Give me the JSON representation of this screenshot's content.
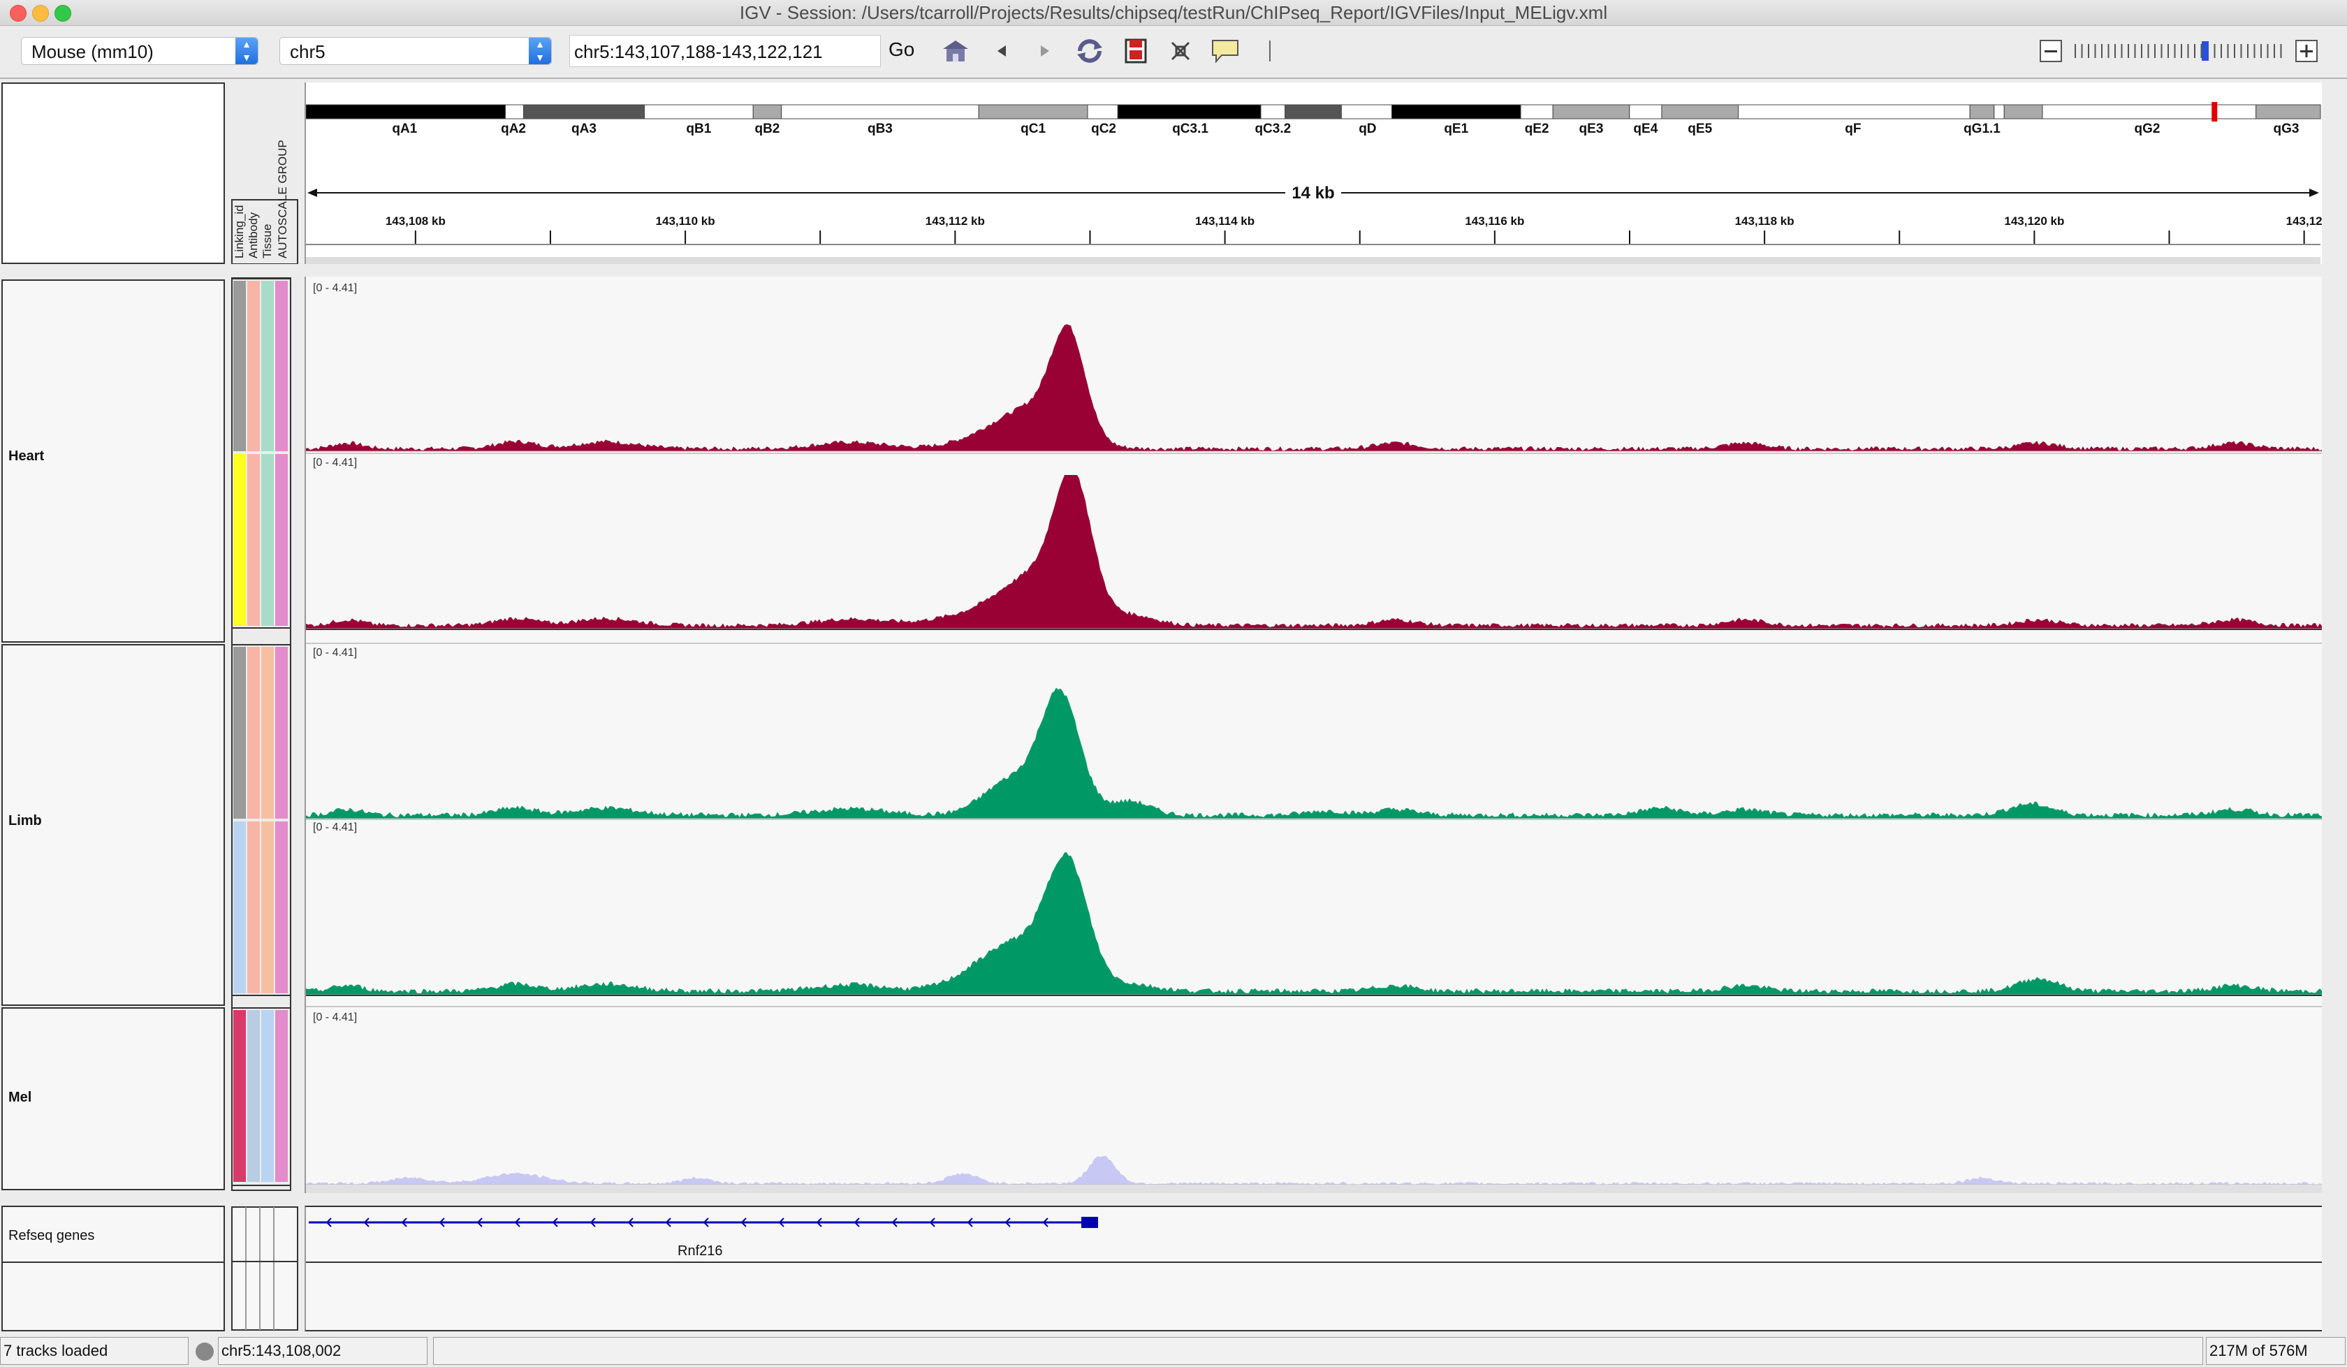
{
  "window": {
    "title": "IGV - Session: /Users/tcarroll/Projects/Results/chipseq/testRun/ChIPseq_Report/IGVFiles/Input_MELigv.xml"
  },
  "toolbar": {
    "genome": "Mouse (mm10)",
    "chromosome": "chr5",
    "locus": "chr5:143,107,188-143,122,121",
    "go_label": "Go",
    "icons": [
      "home-icon",
      "back-icon",
      "forward-icon",
      "refresh-icon",
      "region-icon",
      "resize-icon",
      "popup-text-icon",
      "ruler-divider-icon"
    ]
  },
  "ideogram": {
    "bands": [
      "qA1",
      "qA2",
      "qA3",
      "qB1",
      "qB2",
      "qB3",
      "qC1",
      "qC2",
      "qC3.1",
      "qC3.2",
      "qD",
      "qE1",
      "qE2",
      "qE3",
      "qE4",
      "qE5",
      "qF",
      "qG1.1",
      "qG2",
      "qG3"
    ]
  },
  "ruler": {
    "span_label": "14 kb",
    "ticks": [
      "143,108 kb",
      "143,110 kb",
      "143,112 kb",
      "143,114 kb",
      "143,116 kb",
      "143,118 kb",
      "143,120 kb",
      "143,12"
    ]
  },
  "attributes": {
    "headers": [
      "Linking_id",
      "Antibody",
      "Tissue",
      "AUTOSCALE GROUP"
    ]
  },
  "groups": [
    {
      "name": "Heart",
      "color": "#990033",
      "tracks": [
        {
          "range": "[0 - 4.41]"
        },
        {
          "range": "[0 - 4.41]"
        }
      ]
    },
    {
      "name": "Limb",
      "color": "#009966",
      "tracks": [
        {
          "range": "[0 - 4.41]"
        },
        {
          "range": "[0 - 4.41]"
        }
      ]
    },
    {
      "name": "Mel",
      "color": "#c8c8f5",
      "tracks": [
        {
          "range": "[0 - 4.41]"
        }
      ]
    }
  ],
  "genes": {
    "track_name": "Refseq genes",
    "gene_name": "Rnf216",
    "gene_color": "#0000b2"
  },
  "status": {
    "tracks_loaded": "7 tracks loaded",
    "position": "chr5:143,108,002",
    "memory": "217M of 576M"
  }
}
